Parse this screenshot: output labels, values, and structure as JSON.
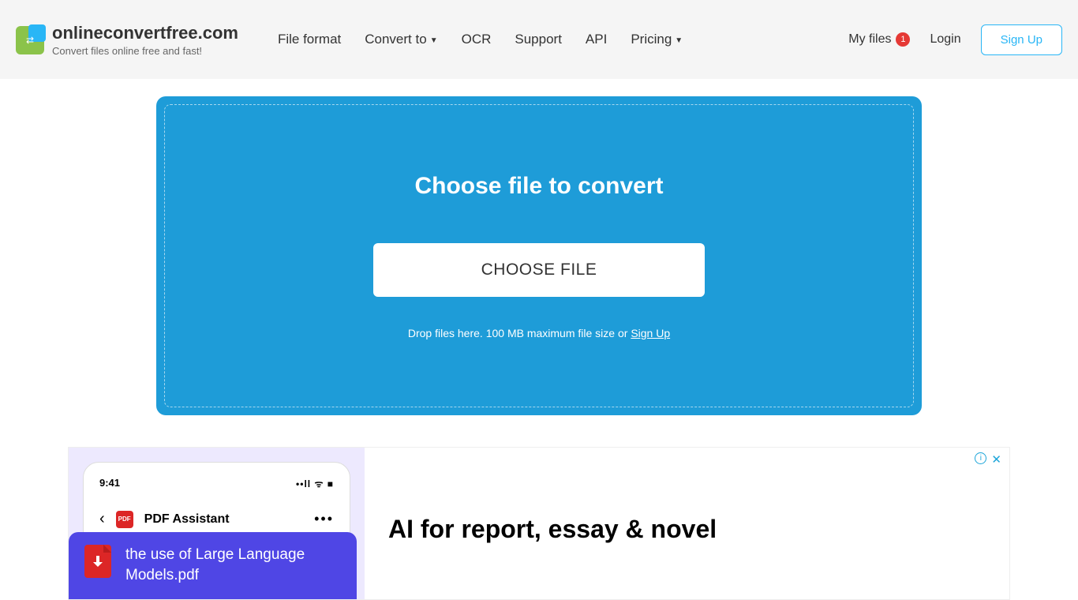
{
  "site": {
    "title": "onlineconvertfree.com",
    "subtitle": "Convert files online free and fast!"
  },
  "nav": {
    "file_format": "File format",
    "convert_to": "Convert to",
    "ocr": "OCR",
    "support": "Support",
    "api": "API",
    "pricing": "Pricing"
  },
  "right_nav": {
    "my_files": "My files",
    "badge_count": "1",
    "login": "Login",
    "signup": "Sign Up"
  },
  "upload": {
    "title": "Choose file to convert",
    "button": "CHOOSE FILE",
    "drop_text": "Drop files here. 100 MB maximum file size or ",
    "signup_link": "Sign Up"
  },
  "ad": {
    "phone_time": "9:41",
    "pdf_label": "PDF",
    "phone_app_title": "PDF Assistant",
    "file_name": "the use of Large Language Models.pdf",
    "headline": "AI for report, essay & novel",
    "info_icon": "i",
    "close_icon": "✕"
  }
}
